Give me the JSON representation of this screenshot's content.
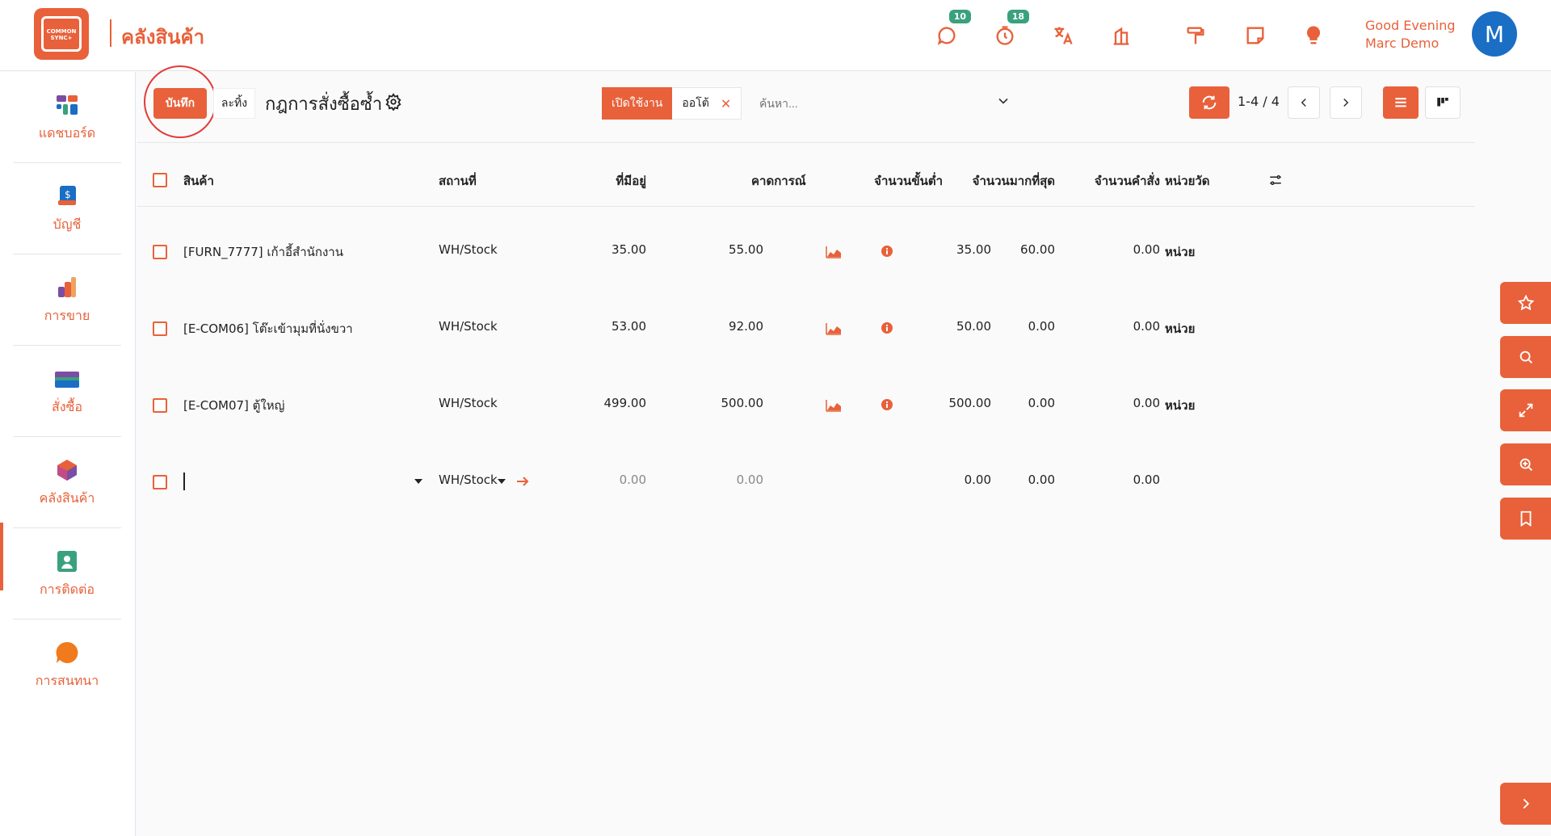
{
  "brand": {
    "logo_text": "COMMON SYNC+",
    "app_title": "คลังสินค้า"
  },
  "header": {
    "chat_badge": "10",
    "timer_badge": "18",
    "greeting_line1": "Good Evening",
    "greeting_line2": "Marc Demo",
    "avatar_initial": "M"
  },
  "sidebar": {
    "items": [
      {
        "label": "แดชบอร์ด",
        "icon": "dashboard-icon"
      },
      {
        "label": "บัญชี",
        "icon": "accounting-icon"
      },
      {
        "label": "การขาย",
        "icon": "sales-icon"
      },
      {
        "label": "สั่งซื้อ",
        "icon": "purchase-icon"
      },
      {
        "label": "คลังสินค้า",
        "icon": "inventory-icon"
      },
      {
        "label": "การติดต่อ",
        "icon": "contacts-icon"
      },
      {
        "label": "การสนทนา",
        "icon": "discuss-icon"
      }
    ],
    "active_index": 4
  },
  "toolbar": {
    "save_label": "บันทึก",
    "discard_label": "ละทิ้ง",
    "title": "กฎการสั่งซื้อซ้ำ",
    "facet_label": "เปิดใช้งาน",
    "facet_value": "ออโต้",
    "search_placeholder": "ค้นหา...",
    "pager": "1-4 / 4"
  },
  "table": {
    "columns": {
      "product": "สินค้า",
      "location": "สถานที่",
      "on_hand": "ที่มีอยู่",
      "forecast": "คาดการณ์",
      "min_qty": "จำนวนขั้นต่ำ",
      "max_qty": "จำนวนมากที่สุด",
      "to_order": "จำนวนคำสั่ง",
      "uom": "หน่วยวัด"
    },
    "rows": [
      {
        "product": "[FURN_7777] เก้าอี้สำนักงาน",
        "location": "WH/Stock",
        "on_hand": "35.00",
        "forecast": "55.00",
        "min_qty": "35.00",
        "max_qty": "60.00",
        "to_order": "0.00",
        "uom": "หน่วย"
      },
      {
        "product": "[E-COM06] โต๊ะเข้ามุมที่นั่งขวา",
        "location": "WH/Stock",
        "on_hand": "53.00",
        "forecast": "92.00",
        "min_qty": "50.00",
        "max_qty": "0.00",
        "to_order": "0.00",
        "uom": "หน่วย"
      },
      {
        "product": "[E-COM07] ตู้ใหญ่",
        "location": "WH/Stock",
        "on_hand": "499.00",
        "forecast": "500.00",
        "min_qty": "500.00",
        "max_qty": "0.00",
        "to_order": "0.00",
        "uom": "หน่วย"
      }
    ],
    "new_row": {
      "product": "",
      "location": "WH/Stock",
      "on_hand": "0.00",
      "forecast": "0.00",
      "min_qty": "0.00",
      "max_qty": "0.00",
      "to_order": "0.00"
    }
  },
  "colors": {
    "accent": "#e8613a",
    "badge": "#3aa17e",
    "avatar": "#1a6ec4"
  }
}
